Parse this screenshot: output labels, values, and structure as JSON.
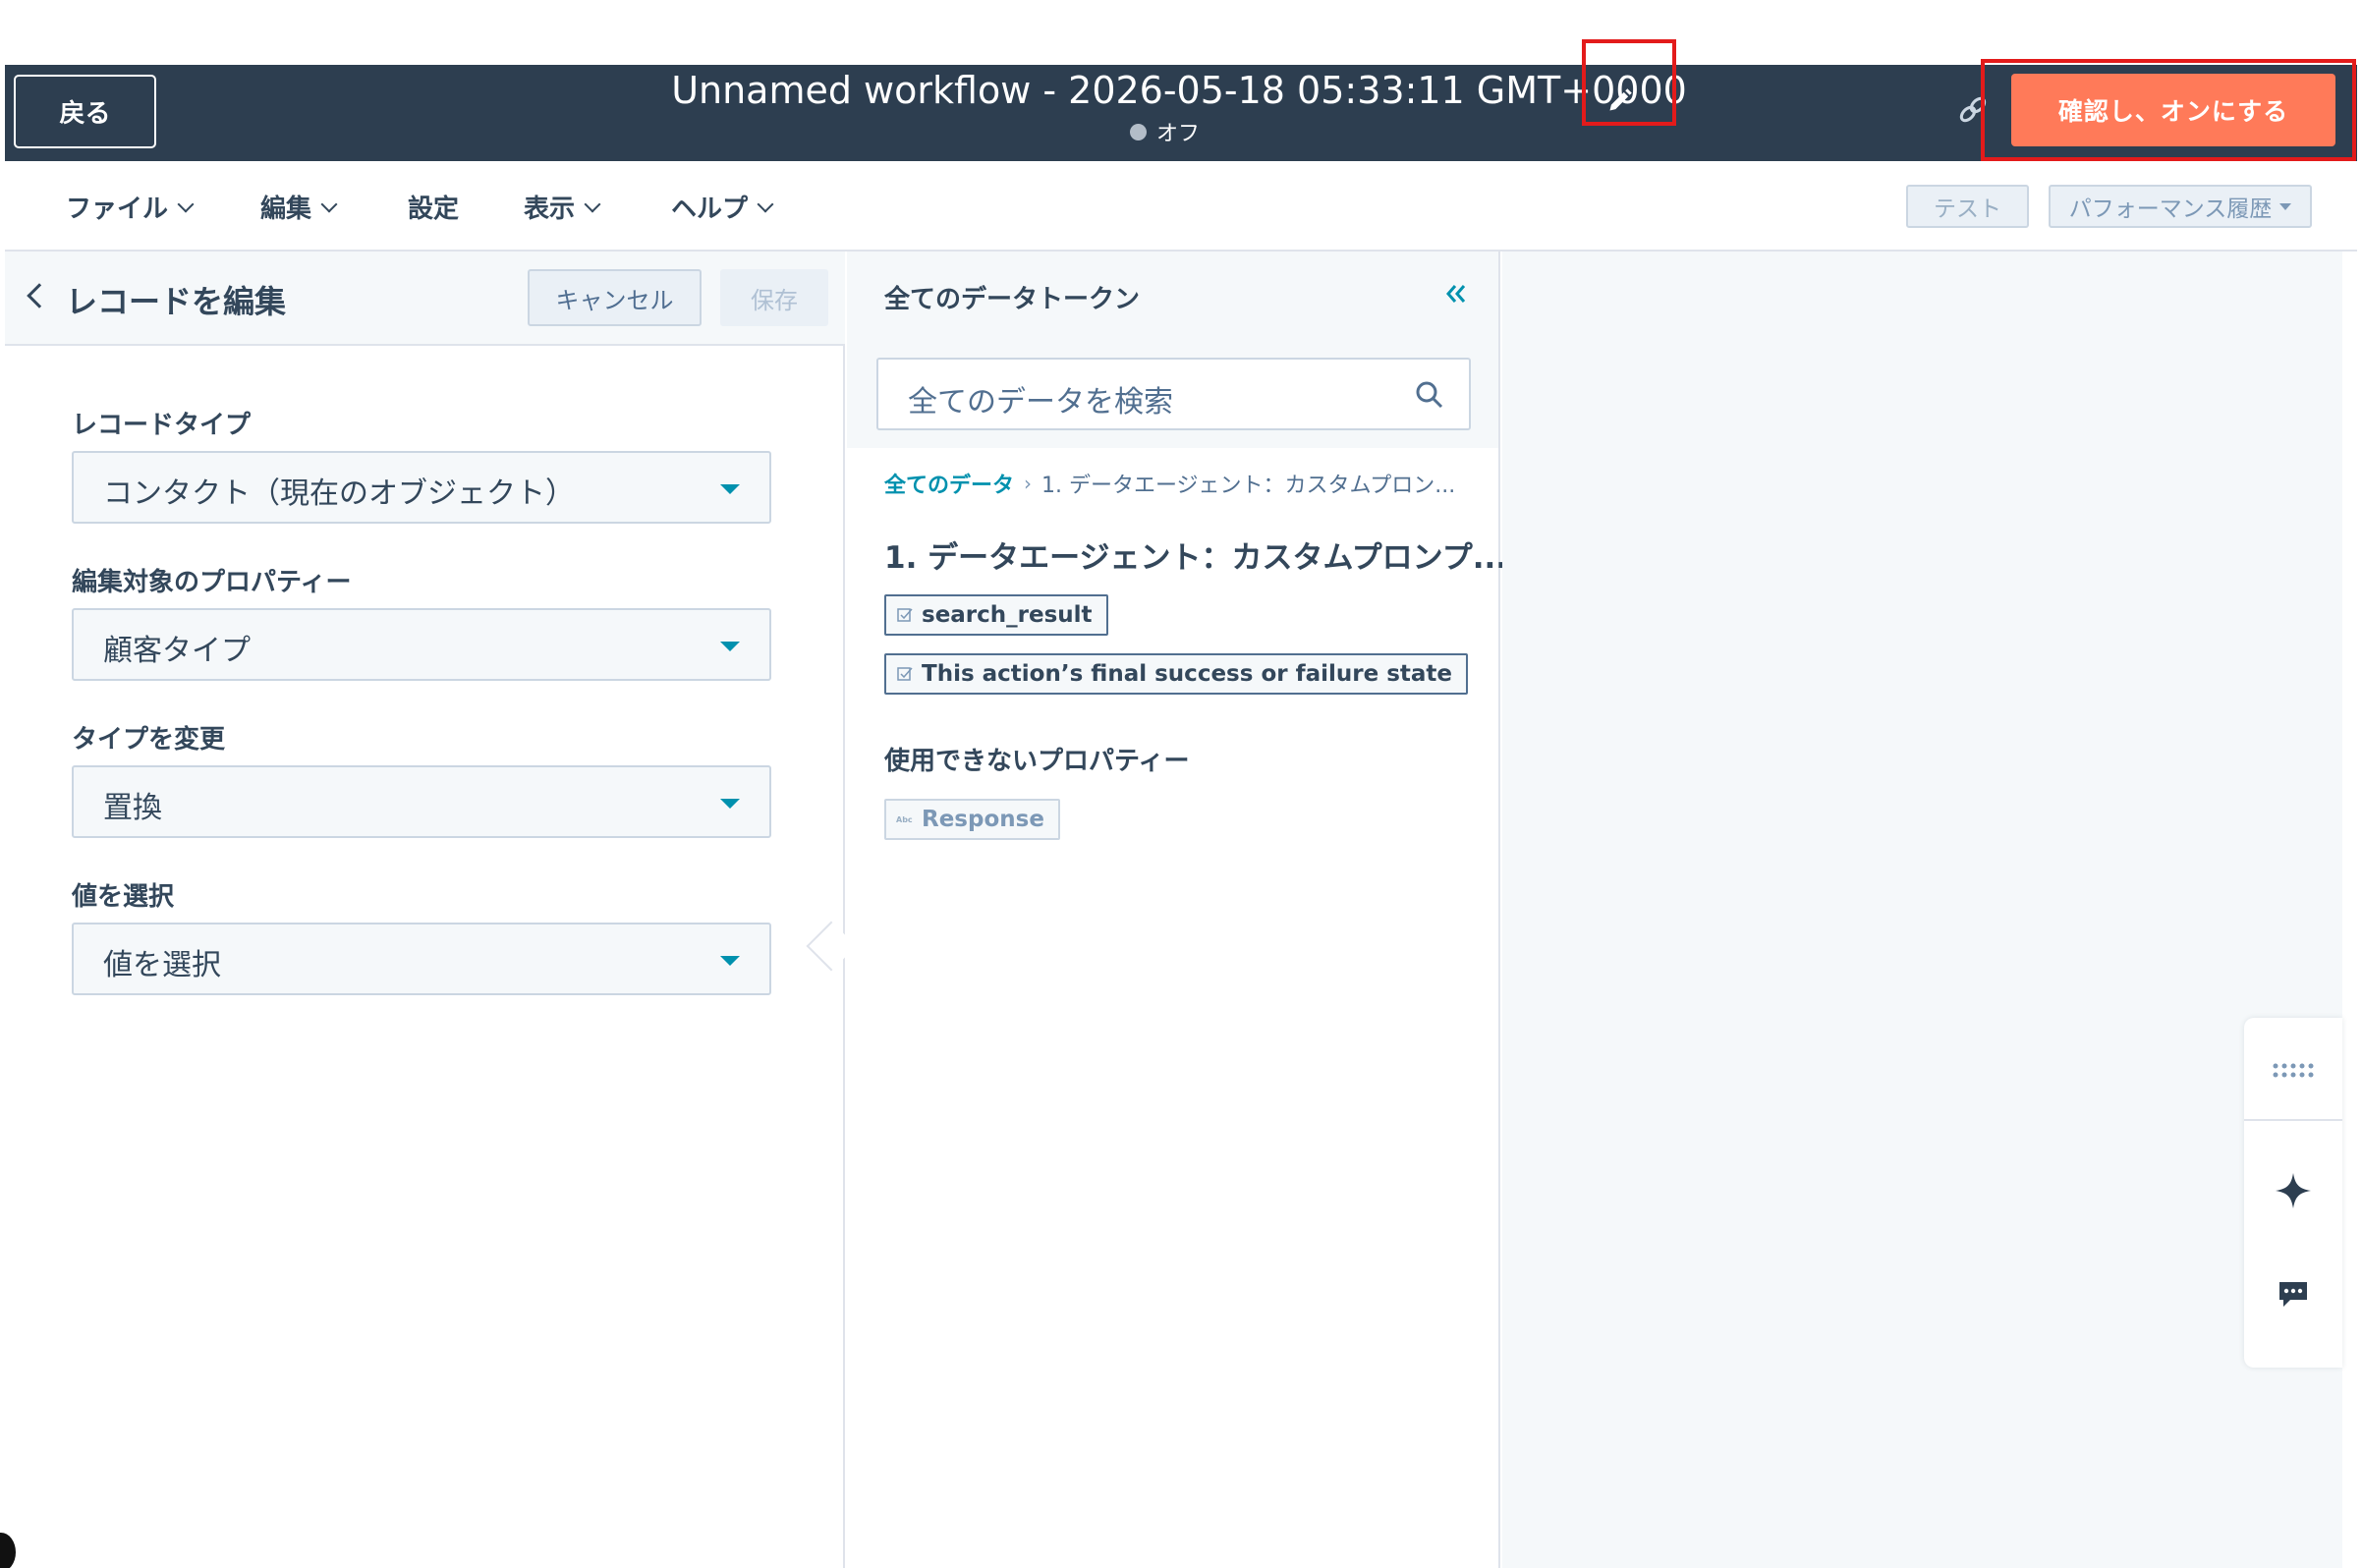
{
  "header": {
    "back_label": "戻る",
    "workflow_title": "Unnamed workflow - 2026-05-18 05:33:11 GMT+0000",
    "status_label": "オフ",
    "confirm_label": "確認し、オンにする",
    "edit_icon": "pencil-icon",
    "link_icon": "link-icon"
  },
  "menu": {
    "items": [
      {
        "label": "ファイル",
        "has_dropdown": true
      },
      {
        "label": "編集",
        "has_dropdown": true
      },
      {
        "label": "設定",
        "has_dropdown": false
      },
      {
        "label": "表示",
        "has_dropdown": true
      },
      {
        "label": "ヘルプ",
        "has_dropdown": true
      }
    ],
    "test_label": "テスト",
    "perf_label": "パフォーマンス履歴"
  },
  "left_panel": {
    "title": "レコードを編集",
    "cancel_label": "キャンセル",
    "save_label": "保存",
    "fields": [
      {
        "label": "レコードタイプ",
        "value": "コンタクト（現在のオブジェクト）"
      },
      {
        "label": "編集対象のプロパティー",
        "value": "顧客タイプ"
      },
      {
        "label": "タイプを変更",
        "value": "置換"
      },
      {
        "label": "値を選択",
        "value": "値を選択"
      }
    ]
  },
  "data_panel": {
    "title": "全てのデータトークン",
    "search_placeholder": "全てのデータを検索",
    "breadcrumb": {
      "root": "全てのデータ",
      "current": "1. データエージェント：カスタムプロン..."
    },
    "group_title": "1. データエージェント：カスタムプロンプ...",
    "tokens": [
      "search_result",
      "This action’s final success or failure state"
    ],
    "unavailable_title": "使用できないプロパティー",
    "unavailable_tokens": [
      "Response"
    ]
  },
  "colors": {
    "header_bg": "#2d3e50",
    "accent_orange": "#ff7a59",
    "link_teal": "#0091ae",
    "highlight_red": "#e31b1b"
  }
}
